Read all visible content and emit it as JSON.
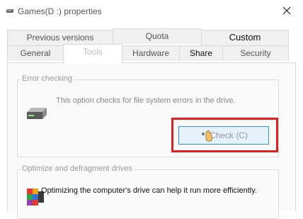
{
  "window": {
    "title": "Games(D :) properties"
  },
  "tabs": {
    "row1": [
      "Previous versions",
      "Quota",
      "Custom"
    ],
    "row2": [
      "General",
      "Tools",
      "Hardware",
      "Share",
      "Security"
    ],
    "active": "Tools"
  },
  "error_checking": {
    "legend": "Error checking",
    "description": "This option checks for file system errors in the drive.",
    "button": "Check (C)"
  },
  "optimize": {
    "legend": "Optimize and defragment drives",
    "description": "Optimizing the computer's drive can help it run more efficiently."
  },
  "colors": {
    "highlight_box": "#e02020",
    "button_focus": "#3c8fd0"
  }
}
